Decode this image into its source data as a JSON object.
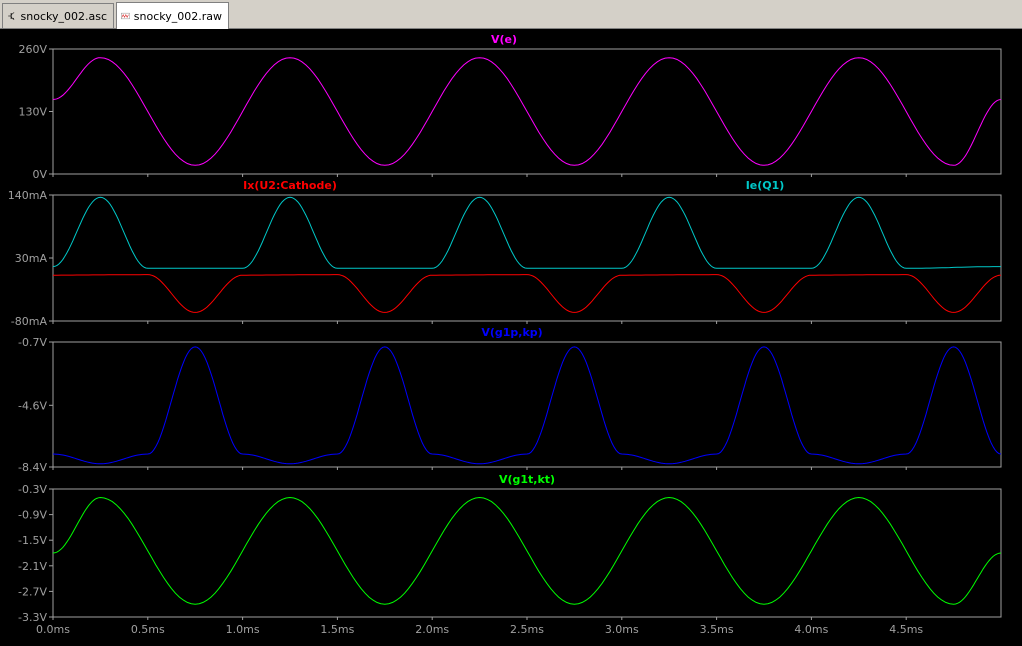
{
  "tabs": [
    {
      "label": "snocky_002.asc",
      "icon": "schematic-icon",
      "active": false
    },
    {
      "label": "snocky_002.raw",
      "icon": "waveform-icon",
      "active": true
    }
  ],
  "colors": {
    "background": "#000000",
    "axis": "#a0a0a0",
    "tick_label": "#a0a0a0",
    "v_e": "#ff00ff",
    "ix_cathode": "#ff0000",
    "ie_q1": "#00c8c8",
    "v_g1p_kp": "#0000ff",
    "v_g1t_kt": "#00ff00"
  },
  "x_axis": {
    "unit": "ms",
    "range": [
      0,
      5.0
    ],
    "tick_values": [
      0,
      0.5,
      1.0,
      1.5,
      2.0,
      2.5,
      3.0,
      3.5,
      4.0,
      4.5
    ],
    "tick_labels": [
      "0.0ms",
      "0.5ms",
      "1.0ms",
      "1.5ms",
      "2.0ms",
      "2.5ms",
      "3.0ms",
      "3.5ms",
      "4.0ms",
      "4.5ms"
    ]
  },
  "chart_data": [
    {
      "type": "line",
      "ylim": [
        0,
        260
      ],
      "y_tick_values": [
        260,
        130,
        0
      ],
      "y_tick_labels": [
        "260V",
        "130V",
        "0V"
      ],
      "series": [
        {
          "name": "V(e)",
          "color": "#ff00ff",
          "x": [
            0,
            0.25,
            0.75,
            1.25,
            1.75,
            2.25,
            2.75,
            3.25,
            3.75,
            4.25,
            4.75,
            5.0
          ],
          "y": [
            155,
            242,
            18,
            242,
            18,
            242,
            18,
            242,
            18,
            242,
            18,
            155
          ]
        }
      ]
    },
    {
      "type": "line",
      "ylim": [
        -80,
        140
      ],
      "y_tick_values": [
        140,
        30,
        -80
      ],
      "y_tick_labels": [
        "140mA",
        "30mA",
        "-80mA"
      ],
      "series": [
        {
          "name": "Ix(U2:Cathode)",
          "color": "#ff0000",
          "x": [
            0,
            0.5,
            0.75,
            1.0,
            1.5,
            1.75,
            2.0,
            2.5,
            2.75,
            3.0,
            3.5,
            3.75,
            4.0,
            4.5,
            4.75,
            5.0
          ],
          "y": [
            0,
            1,
            -65,
            0,
            1,
            -65,
            0,
            1,
            -65,
            0,
            1,
            -65,
            0,
            1,
            -65,
            0
          ]
        },
        {
          "name": "Ie(Q1)",
          "color": "#00c8c8",
          "x": [
            0,
            0.25,
            0.5,
            1.0,
            1.25,
            1.5,
            2.0,
            2.25,
            2.5,
            3.0,
            3.25,
            3.5,
            4.0,
            4.25,
            4.5,
            5.0
          ],
          "y": [
            15,
            136,
            12,
            12,
            136,
            12,
            12,
            136,
            12,
            12,
            136,
            12,
            12,
            136,
            12,
            15
          ]
        }
      ]
    },
    {
      "type": "line",
      "ylim": [
        -8.4,
        -0.7
      ],
      "y_tick_values": [
        -0.7,
        -4.6,
        -8.4
      ],
      "y_tick_labels": [
        "-0.7V",
        "-4.6V",
        "-8.4V"
      ],
      "series": [
        {
          "name": "V(g1p,kp)",
          "color": "#0000ff",
          "x": [
            0,
            0.25,
            0.5,
            0.75,
            1.0,
            1.25,
            1.5,
            1.75,
            2.0,
            2.25,
            2.5,
            2.75,
            3.0,
            3.25,
            3.5,
            3.75,
            4.0,
            4.25,
            4.5,
            4.75,
            5.0
          ],
          "y": [
            -7.6,
            -8.2,
            -7.6,
            -1.0,
            -7.6,
            -8.2,
            -7.6,
            -1.0,
            -7.6,
            -8.2,
            -7.6,
            -1.0,
            -7.6,
            -8.2,
            -7.6,
            -1.0,
            -7.6,
            -8.2,
            -7.6,
            -1.0,
            -7.6
          ]
        }
      ]
    },
    {
      "type": "line",
      "ylim": [
        -3.3,
        -0.3
      ],
      "y_tick_values": [
        -0.3,
        -0.9,
        -1.5,
        -2.1,
        -2.7,
        -3.3
      ],
      "y_tick_labels": [
        "-0.3V",
        "-0.9V",
        "-1.5V",
        "-2.1V",
        "-2.7V",
        "-3.3V"
      ],
      "series": [
        {
          "name": "V(g1t,kt)",
          "color": "#00ff00",
          "x": [
            0,
            0.25,
            0.75,
            1.25,
            1.75,
            2.25,
            2.75,
            3.25,
            3.75,
            4.25,
            4.75,
            5.0
          ],
          "y": [
            -1.8,
            -0.5,
            -3.0,
            -0.5,
            -3.0,
            -0.5,
            -3.0,
            -0.5,
            -3.0,
            -0.5,
            -3.0,
            -1.8
          ]
        }
      ]
    }
  ]
}
